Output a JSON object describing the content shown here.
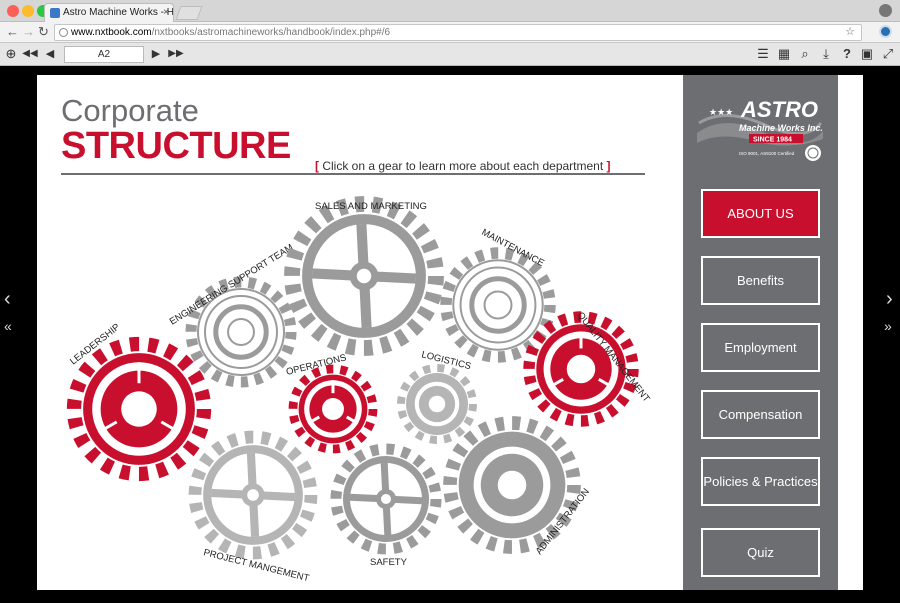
{
  "browser": {
    "tab_title": "Astro Machine Works - Handbo",
    "tab_close": "×",
    "url_host": "www.nxtbook.com",
    "url_path": "/nxtbooks/astromachineworks/handbook/index.php#/6"
  },
  "viewer_toolbar": {
    "page_value": "A2"
  },
  "page": {
    "title_line1": "Corporate",
    "title_line2": "STRUCTURE",
    "instruction_open": "[",
    "instruction_text": "Click on a gear to learn more about each department",
    "instruction_close": "]"
  },
  "gears": [
    {
      "label": "LEADERSHIP",
      "color": "#c8102e"
    },
    {
      "label": "ENGINEERING SUPPORT TEAM",
      "color": "#9b9b9b"
    },
    {
      "label": "SALES AND MARKETING",
      "color": "#9b9b9b"
    },
    {
      "label": "MAINTENANCE",
      "color": "#9b9b9b"
    },
    {
      "label": "QUALITY MANAGEMENT",
      "color": "#c8102e"
    },
    {
      "label": "OPERATIONS",
      "color": "#c8102e"
    },
    {
      "label": "LOGISTICS",
      "color": "#b5b5b5"
    },
    {
      "label": "PROJECT MANGEMENT",
      "color": "#b5b5b5"
    },
    {
      "label": "SAFETY",
      "color": "#9b9b9b"
    },
    {
      "label": "ADMINISTRATION",
      "color": "#9b9b9b"
    }
  ],
  "logo": {
    "brand": "ASTRO",
    "subtitle": "Machine Works Inc.",
    "since": "SINCE 1984",
    "cert": "ISO 9001, AS9100 Certified"
  },
  "menu": [
    {
      "label": "ABOUT US",
      "active": true
    },
    {
      "label": "Benefits",
      "active": false
    },
    {
      "label": "Employment",
      "active": false
    },
    {
      "label": "Compensation",
      "active": false
    },
    {
      "label": "Policies & Practices",
      "active": false
    },
    {
      "label": "Quiz",
      "active": false
    }
  ],
  "colors": {
    "accent": "#c8102e",
    "sidebar": "#6d6e71",
    "gear_gray": "#9b9b9b",
    "gear_light": "#b5b5b5"
  }
}
